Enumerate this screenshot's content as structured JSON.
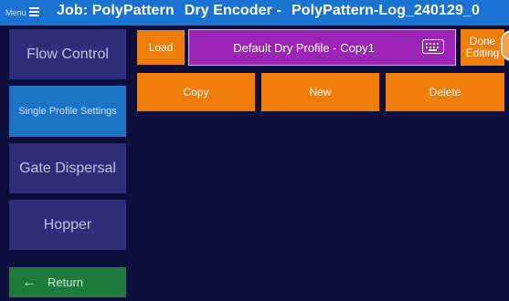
{
  "header": {
    "menu_label": "Menu",
    "job": "Job: PolyPattern",
    "encoder": "Dry Encoder -",
    "log": "PolyPattern-Log_240129_0"
  },
  "sidebar": {
    "items": [
      {
        "label": "Flow Control"
      },
      {
        "label": "Single Profile Settings"
      },
      {
        "label": "Gate Dispersal"
      },
      {
        "label": "Hopper"
      }
    ],
    "return_label": "Return"
  },
  "toolbar": {
    "load_label": "Load",
    "profile_name": "Default Dry Profile - Copy1",
    "done_line1": "Done",
    "done_line2": "Editing"
  },
  "actions": {
    "copy_label": "Copy",
    "new_label": "New",
    "delete_label": "Delete"
  },
  "colors": {
    "header": "#1a73d0",
    "background": "#0c0e3c",
    "sidebar_button": "#2e2f7a",
    "sidebar_active": "#1d74c6",
    "return_button": "#1f7a3e",
    "action_orange": "#ef7d0c",
    "profile_field": "#9d25b5"
  },
  "icons": {
    "menu": "hamburger-icon",
    "return": "left-arrow-icon",
    "keyboard": "keyboard-icon"
  }
}
